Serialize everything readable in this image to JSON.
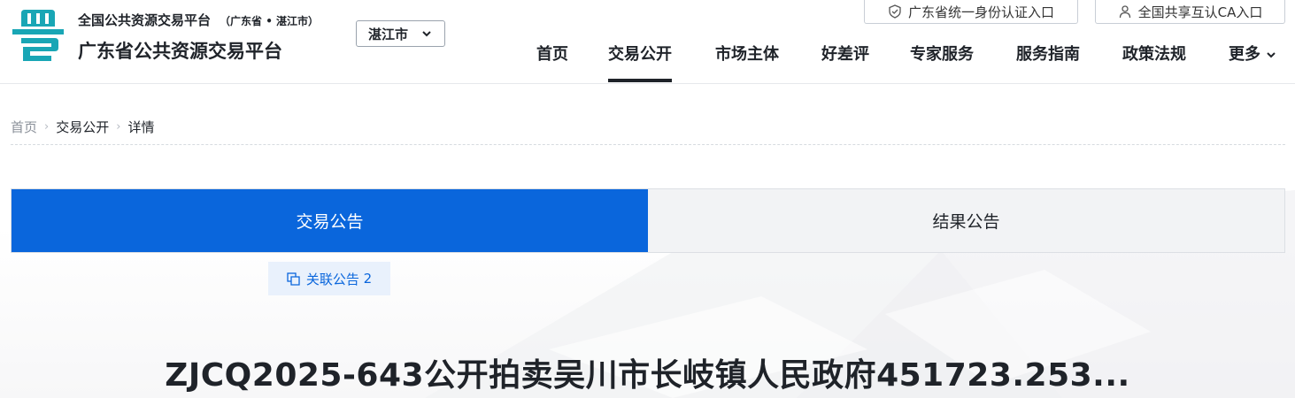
{
  "header": {
    "site_subtitle": "全国公共资源交易平台",
    "region_label": "（广东省 • 湛江市）",
    "site_title": "广东省公共资源交易平台",
    "logo_text": "粤",
    "city_select": {
      "value": "湛江市"
    },
    "auth_links": [
      "广东省统一身份认证入口",
      "全国共享互认CA入口"
    ],
    "nav": [
      {
        "label": "首页",
        "active": false
      },
      {
        "label": "交易公开",
        "active": true
      },
      {
        "label": "市场主体",
        "active": false
      },
      {
        "label": "好差评",
        "active": false
      },
      {
        "label": "专家服务",
        "active": false
      },
      {
        "label": "服务指南",
        "active": false
      },
      {
        "label": "政策法规",
        "active": false
      },
      {
        "label": "更多",
        "active": false
      }
    ]
  },
  "breadcrumb": [
    "首页",
    "交易公开",
    "详情"
  ],
  "tabs": [
    {
      "label": "交易公告",
      "active": true
    },
    {
      "label": "结果公告",
      "active": false
    }
  ],
  "related_notice": {
    "label": "关联公告",
    "count": "2"
  },
  "document": {
    "title": "ZJCQ2025-643公开拍卖吴川市长岐镇人民政府451723.253..."
  },
  "colors": {
    "accent": "#0a66dc",
    "logo_teal": "#19a6b5",
    "text": "#1f2329",
    "related_bg": "#e9f1fc",
    "tab_inactive_bg": "#f2f3f5"
  },
  "icons": [
    "logo-icon",
    "chevron-down-icon",
    "shield-icon",
    "user-icon",
    "copy-icon",
    "breadcrumb-separator-icon"
  ]
}
